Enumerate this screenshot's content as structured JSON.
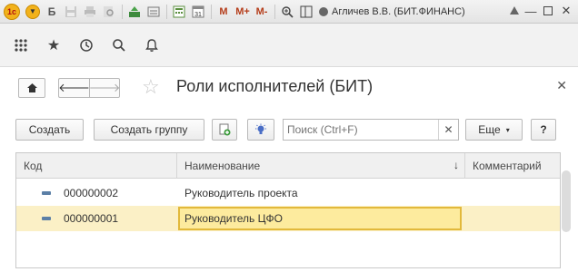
{
  "titlebar": {
    "logo": "1с",
    "letter_b": "Б",
    "mem_m": "M",
    "mem_mplus": "M+",
    "mem_mminus": "M-",
    "user": "Агличев В.В. (БИТ.ФИНАНС)"
  },
  "form": {
    "title": "Роли исполнителей (БИТ)",
    "buttons": {
      "create": "Создать",
      "create_group": "Создать группу",
      "more": "Еще",
      "help": "?"
    },
    "search": {
      "placeholder": "Поиск (Ctrl+F)",
      "value": ""
    },
    "table": {
      "columns": [
        "Код",
        "Наименование",
        "Комментарий"
      ],
      "rows": [
        {
          "code": "000000002",
          "name": "Руководитель проекта",
          "comment": ""
        },
        {
          "code": "000000001",
          "name": "Руководитель ЦФО",
          "comment": ""
        }
      ],
      "selected_row": 1
    }
  },
  "colors": {
    "selected_row": "#fbf0c6",
    "focus_cell": "#fdeb9e",
    "focus_border": "#e2b93c"
  }
}
